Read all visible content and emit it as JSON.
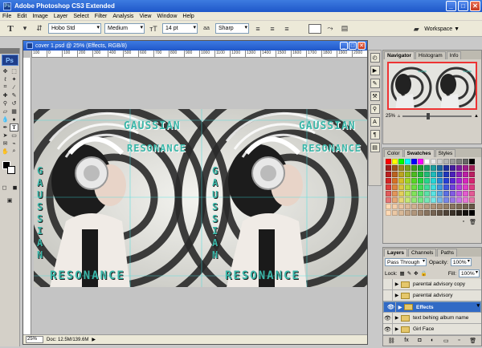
{
  "window": {
    "title": "Adobe Photoshop CS3 Extended",
    "app_badge": "Ps",
    "min": "_",
    "max": "□",
    "close": "✕"
  },
  "menu": [
    "File",
    "Edit",
    "Image",
    "Layer",
    "Select",
    "Filter",
    "Analysis",
    "View",
    "Window",
    "Help"
  ],
  "options": {
    "tool_glyph": "T",
    "font_family": "Hobo Std",
    "font_style": "Medium",
    "font_size": "14 pt",
    "antialias_label": "aa",
    "antialias": "Sharp",
    "workspace": "Workspace ▼"
  },
  "document": {
    "title": "cover 1.psd @ 25% (Effects, RGB/8)",
    "ruler_marks": [
      "100",
      "0",
      "100",
      "200",
      "300",
      "400",
      "500",
      "600",
      "700",
      "800",
      "900",
      "1000",
      "1100",
      "1200",
      "1300",
      "1400",
      "1500",
      "1600",
      "1700",
      "1800",
      "1900",
      "2000"
    ],
    "zoom": "25%",
    "doc_size": "Doc: 12.5M/139.6M",
    "artwork": {
      "line1": "GAUSSIAN",
      "line2": "RESONANCE",
      "vertical": "GAUSSIAN",
      "bottom": "RESONANCE"
    }
  },
  "navigator": {
    "tabs": [
      "Navigator",
      "Histogram",
      "Info"
    ],
    "zoom": "25%"
  },
  "swatches_panel": {
    "tabs": [
      "Color",
      "Swatches",
      "Styles"
    ]
  },
  "layers_panel": {
    "tabs": [
      "Layers",
      "Channels",
      "Paths"
    ],
    "blend_mode": "Pass Through",
    "opacity_label": "Opacity:",
    "opacity": "100%",
    "lock_label": "Lock:",
    "fill_label": "Fill:",
    "fill": "100%",
    "layers": [
      {
        "name": "parental advisory copy",
        "visible": false,
        "selected": false
      },
      {
        "name": "parental advisory",
        "visible": false,
        "selected": false
      },
      {
        "name": "Effects",
        "visible": true,
        "selected": true
      },
      {
        "name": "text behing album name",
        "visible": true,
        "selected": false
      },
      {
        "name": "Girl Face",
        "visible": true,
        "selected": false
      }
    ]
  }
}
